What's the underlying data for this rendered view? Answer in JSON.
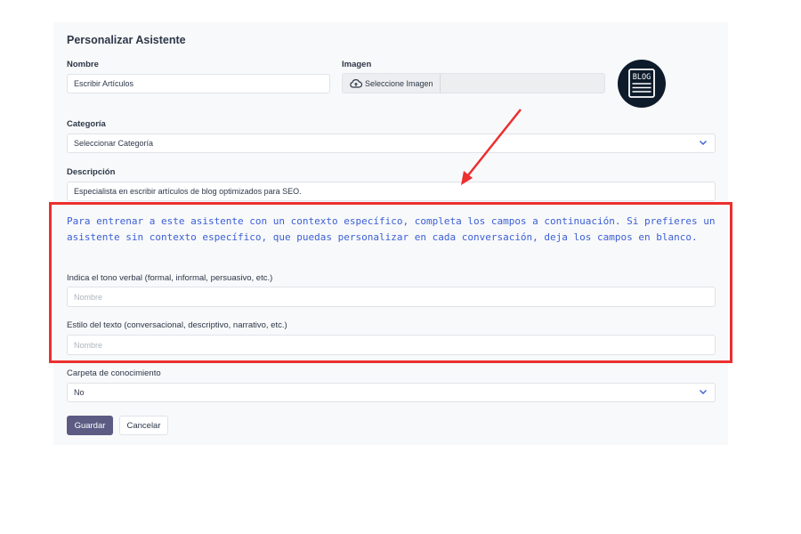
{
  "form": {
    "title": "Personalizar Asistente",
    "name_label": "Nombre",
    "name_value": "Escribir Artículos",
    "image_label": "Imagen",
    "image_button": "Seleccione Imagen",
    "category_label": "Categoría",
    "category_value": "Seleccionar Categoría",
    "description_label": "Descripción",
    "description_value": "Especialista en escribir artículos de blog optimizados para SEO.",
    "context_note": "Para entrenar a este asistente con un contexto específico, completa los campos a continuación. Si prefieres un asistente sin contexto específico, que puedas personalizar en cada conversación, deja los campos en blanco.",
    "tone_label": "Indica el tono verbal (formal, informal, persuasivo, etc.)",
    "tone_placeholder": "Nombre",
    "style_label": "Estilo del texto (conversacional, descriptivo, narrativo, etc.)",
    "style_placeholder": "Nombre",
    "knowledge_label": "Carpeta de conocimiento",
    "knowledge_value": "No",
    "save_button": "Guardar",
    "cancel_button": "Cancelar"
  },
  "logo": {
    "text": "BLOG",
    "icon": "blog-logo-icon"
  },
  "colors": {
    "accent_text": "#3b5fd6",
    "highlight": "#ec2f2f",
    "primary_button": "#5b5b84"
  }
}
